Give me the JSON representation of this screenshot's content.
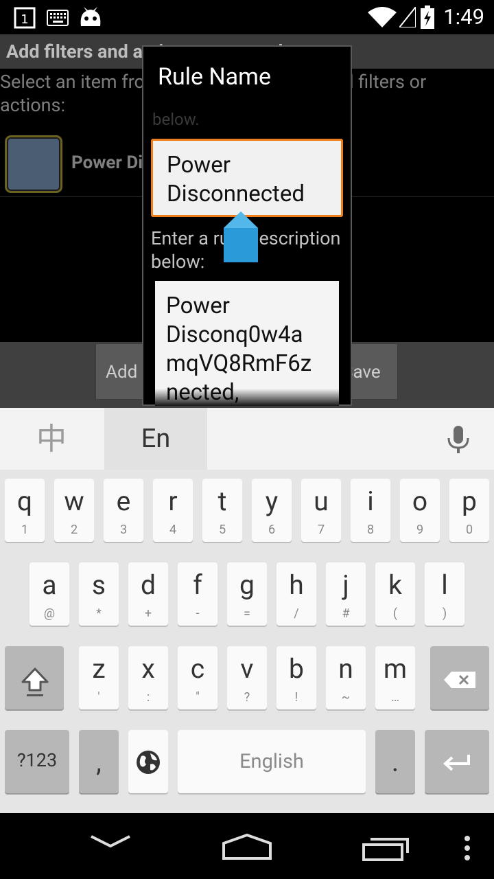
{
  "status_bar": {
    "time": "1:49",
    "notification_badge": "1",
    "icons": [
      "notification-icon",
      "keyboard-icon",
      "cyanogen-icon",
      "wifi-icon",
      "signal-icon",
      "battery-charging-icon"
    ]
  },
  "background": {
    "title": "Add filters and actions to your rule",
    "instructions_line1": "Select an item from the list below, then add filters or",
    "instructions_line2": "actions:",
    "item_label": "Power Disconnected",
    "buttons": {
      "add_filter": "Add Filter",
      "save": "Save"
    }
  },
  "dialog": {
    "title": "Rule Name",
    "hidden_text": "below.",
    "name_value_line1": "Power",
    "name_value_line2": "Disconnected",
    "description_label": "Enter a rule description below:",
    "description_lines": [
      "Power",
      "Disconq0w4a",
      "mqVQ8RmF6z",
      "nected,"
    ]
  },
  "keyboard": {
    "lang_zh": "中",
    "lang_en": "En",
    "row1": [
      {
        "k": "q",
        "s": "1"
      },
      {
        "k": "w",
        "s": "2"
      },
      {
        "k": "e",
        "s": "3"
      },
      {
        "k": "r",
        "s": "4"
      },
      {
        "k": "t",
        "s": "5"
      },
      {
        "k": "y",
        "s": "6"
      },
      {
        "k": "u",
        "s": "7"
      },
      {
        "k": "i",
        "s": "8"
      },
      {
        "k": "o",
        "s": "9"
      },
      {
        "k": "p",
        "s": "0"
      }
    ],
    "row2": [
      {
        "k": "a",
        "s": "@"
      },
      {
        "k": "s",
        "s": "*"
      },
      {
        "k": "d",
        "s": "+"
      },
      {
        "k": "f",
        "s": "-"
      },
      {
        "k": "g",
        "s": "="
      },
      {
        "k": "h",
        "s": "/"
      },
      {
        "k": "j",
        "s": "#"
      },
      {
        "k": "k",
        "s": "("
      },
      {
        "k": "l",
        "s": ")"
      }
    ],
    "row3": [
      {
        "k": "z",
        "s": "'"
      },
      {
        "k": "x",
        "s": ":"
      },
      {
        "k": "c",
        "s": "\""
      },
      {
        "k": "v",
        "s": "?"
      },
      {
        "k": "b",
        "s": "!"
      },
      {
        "k": "n",
        "s": "~"
      },
      {
        "k": "m",
        "s": "…"
      }
    ],
    "symbols_key": "?123",
    "comma_key": ",",
    "space_label": "English",
    "period_key": "."
  },
  "nav_bar": {
    "icons": [
      "back-down-icon",
      "home-icon",
      "recents-icon",
      "menu-dots-icon"
    ]
  }
}
